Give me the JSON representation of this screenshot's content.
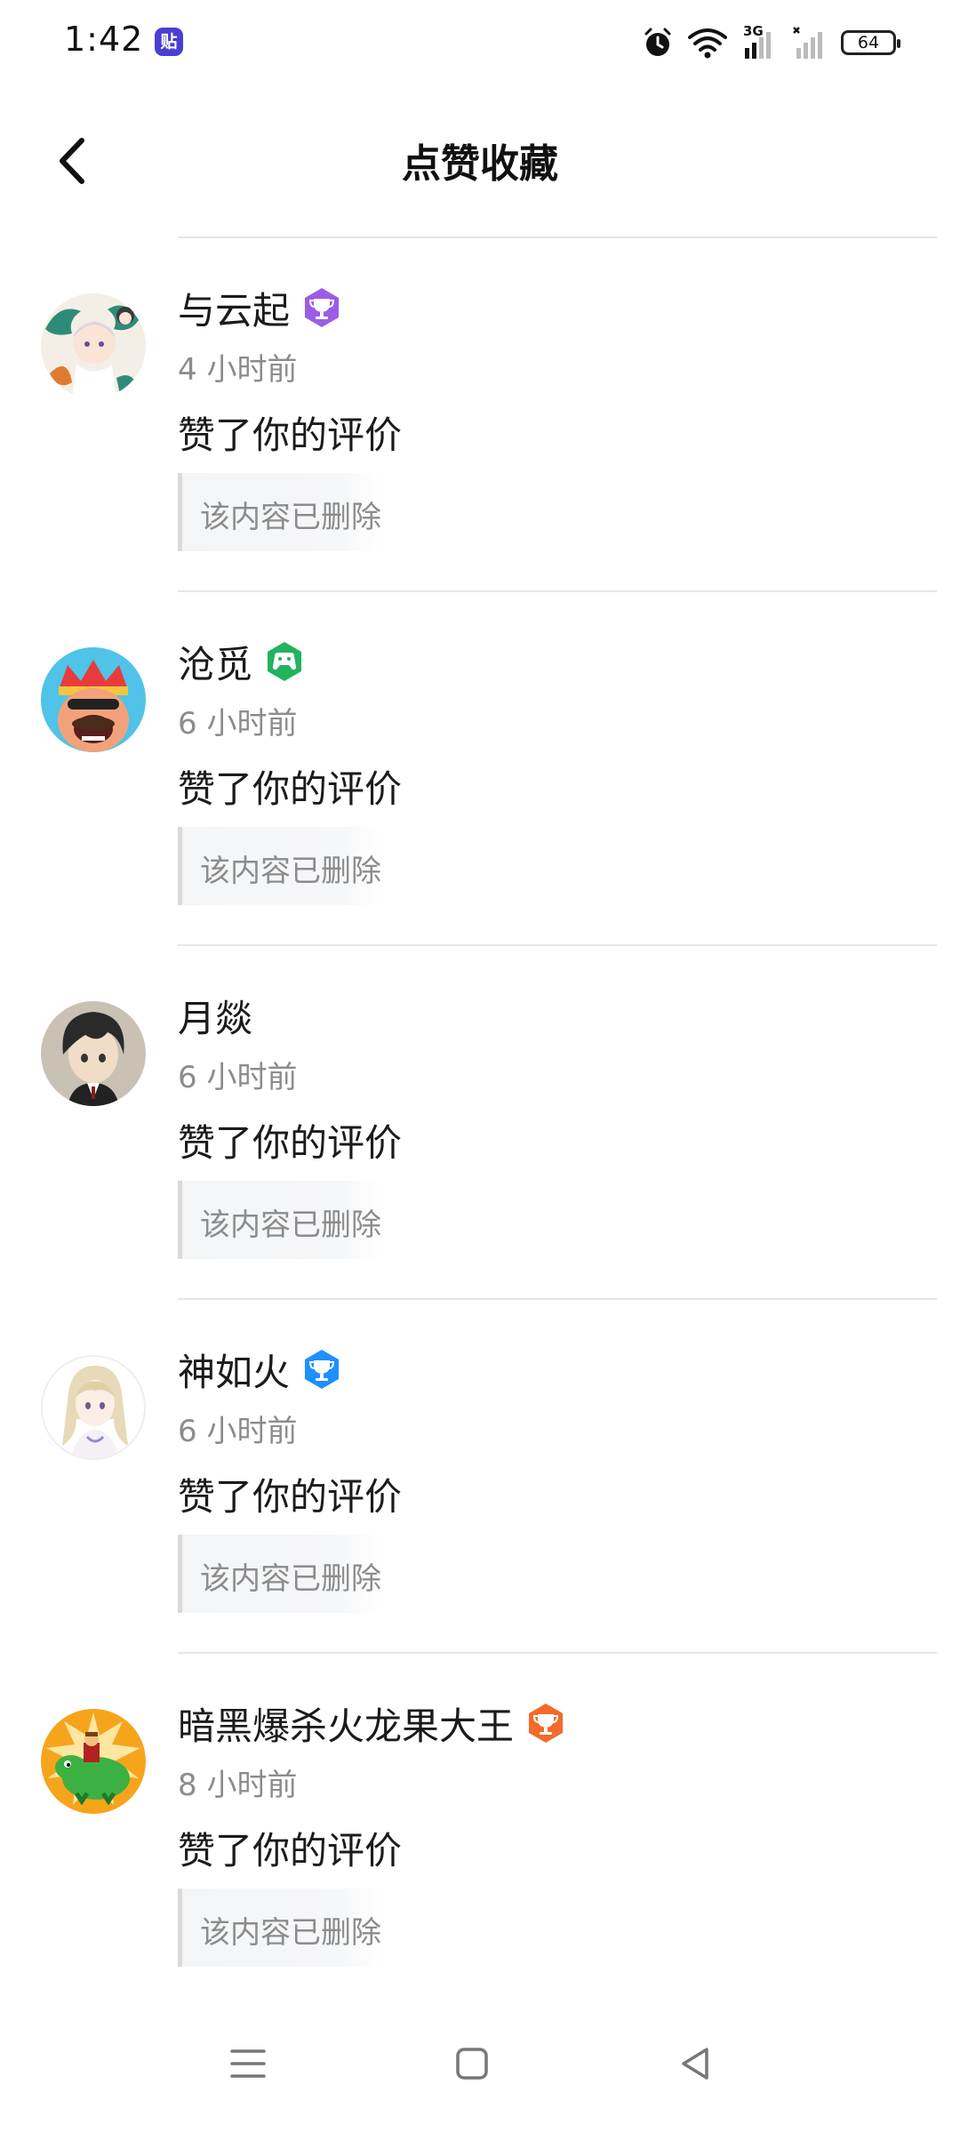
{
  "status_bar": {
    "time": "1:42",
    "app_icon_label": "贴",
    "network_label": "3G",
    "battery": "64"
  },
  "header": {
    "title": "点赞收藏",
    "back_icon": "chevron-left-icon"
  },
  "notifications": [
    {
      "name": "与云起",
      "badge": "trophy-badge",
      "badge_color": "#9b5de5",
      "time": "4 小时前",
      "action": "赞了你的评价",
      "quoted": "该内容已删除"
    },
    {
      "name": "沧觅",
      "badge": "gamepad-badge",
      "badge_color": "#21b35e",
      "time": "6 小时前",
      "action": "赞了你的评价",
      "quoted": "该内容已删除"
    },
    {
      "name": "月燚",
      "time": "6 小时前",
      "action": "赞了你的评价",
      "quoted": "该内容已删除"
    },
    {
      "name": "神如火",
      "badge": "trophy-badge",
      "badge_color": "#1e90ff",
      "time": "6 小时前",
      "action": "赞了你的评价",
      "quoted": "该内容已删除"
    },
    {
      "name": "暗黑爆杀火龙果大王",
      "badge": "trophy-badge",
      "badge_color": "#f26b2a",
      "time": "8 小时前",
      "action": "赞了你的评价",
      "quoted": "该内容已删除"
    }
  ],
  "nav_bar": {
    "menu_icon": "menu-icon",
    "home_icon": "home-square-icon",
    "back_icon": "back-triangle-icon"
  }
}
